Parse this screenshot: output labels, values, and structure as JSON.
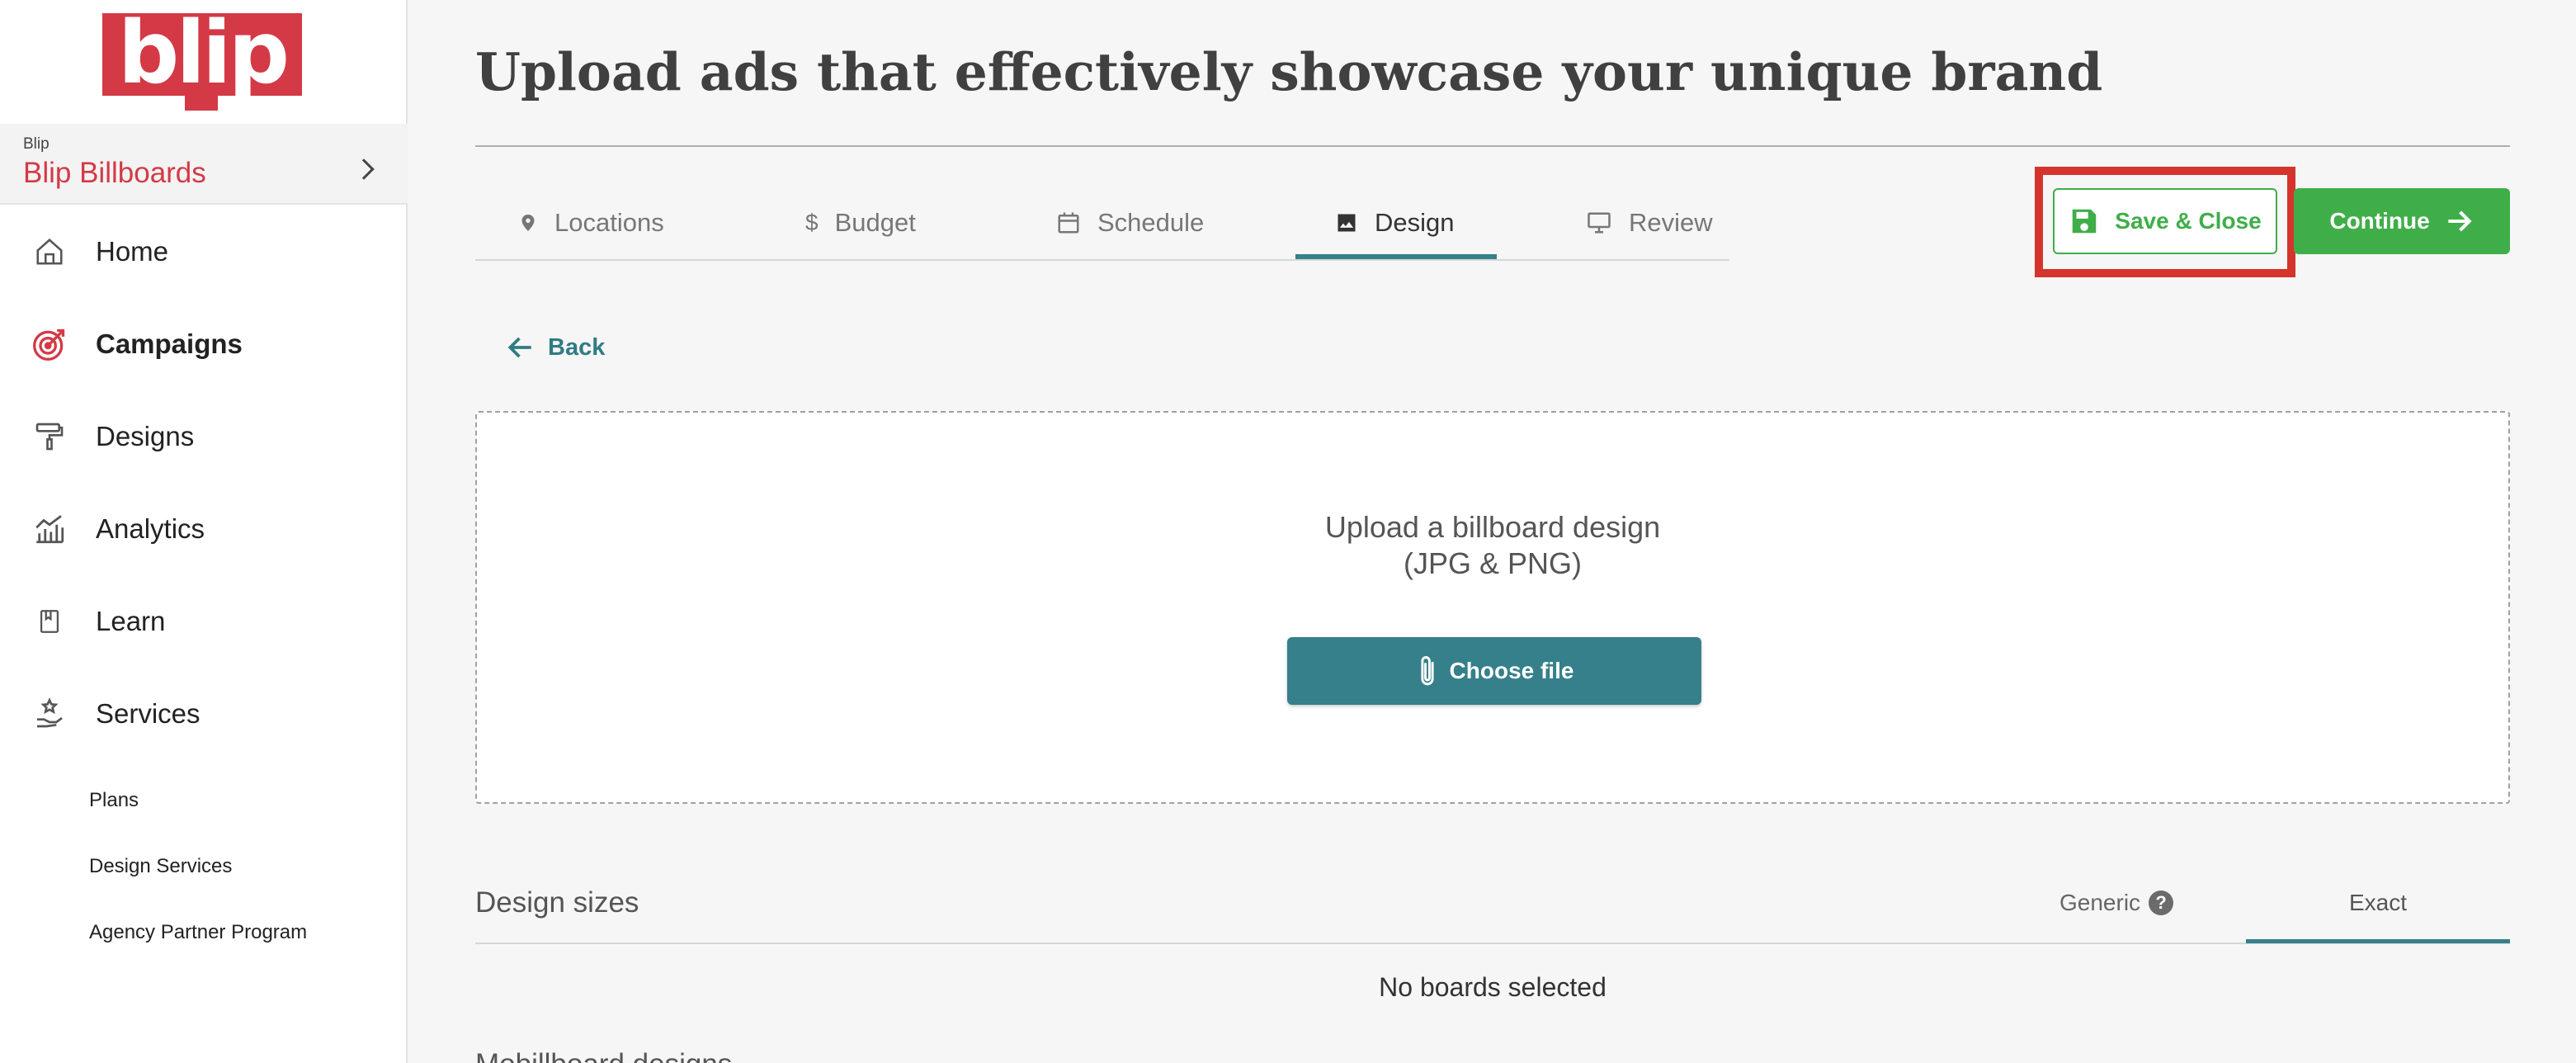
{
  "brand": {
    "logo_text": "blip",
    "account_label": "Blip",
    "account_name": "Blip Billboards",
    "accent": "#d33a46"
  },
  "sidebar": {
    "items": [
      {
        "label": "Home",
        "icon": "home-icon"
      },
      {
        "label": "Campaigns",
        "icon": "target-icon"
      },
      {
        "label": "Designs",
        "icon": "paint-roller-icon"
      },
      {
        "label": "Analytics",
        "icon": "analytics-icon"
      },
      {
        "label": "Learn",
        "icon": "book-icon"
      },
      {
        "label": "Services",
        "icon": "services-icon"
      }
    ],
    "sub_items": [
      "Plans",
      "Design Services",
      "Agency Partner Program"
    ]
  },
  "page": {
    "title": "Upload ads that effectively showcase your unique brand"
  },
  "tabs": [
    {
      "label": "Locations",
      "icon": "location-pin-icon"
    },
    {
      "label": "Budget",
      "icon": "dollar-icon"
    },
    {
      "label": "Schedule",
      "icon": "calendar-icon"
    },
    {
      "label": "Design",
      "icon": "image-icon"
    },
    {
      "label": "Review",
      "icon": "monitor-icon"
    }
  ],
  "active_tab": "Design",
  "actions": {
    "save_close": "Save & Close",
    "continue": "Continue"
  },
  "back_label": "Back",
  "upload": {
    "line1": "Upload a billboard design",
    "line2": "(JPG & PNG)",
    "choose_file": "Choose file"
  },
  "design_sizes": {
    "title": "Design sizes",
    "generic": "Generic",
    "help": "?",
    "exact": "Exact",
    "empty": "No boards selected"
  },
  "mobile_section": "Mobillboard designs",
  "colors": {
    "green": "#3fae49",
    "teal": "#35808a",
    "highlight": "#d4342b"
  }
}
